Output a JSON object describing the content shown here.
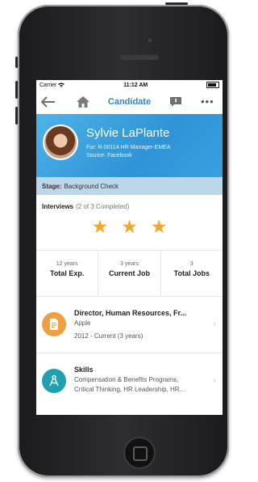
{
  "status_bar": {
    "carrier": "Carrier",
    "time": "11:12 AM"
  },
  "nav": {
    "title": "Candidate",
    "more": "•••",
    "icons": [
      "back-arrow-icon",
      "home-icon",
      "message-icon",
      "more-icon"
    ]
  },
  "candidate": {
    "name": "Sylvie LaPlante",
    "for_line": "For: R-00114 HR Manager-EMEA",
    "source_line": "Source: Facebook"
  },
  "stage": {
    "label": "Stage:",
    "value": "Background Check"
  },
  "interviews": {
    "label": "Interviews",
    "progress": "(2 of 3 Completed)",
    "stars": 3
  },
  "stats": [
    {
      "value": "12 years",
      "label": "Total Exp."
    },
    {
      "value": "3 years",
      "label": "Current Job"
    },
    {
      "value": "3",
      "label": "Total Jobs"
    }
  ],
  "job": {
    "title": "Director, Human Resources, Fr...",
    "company": "Apple",
    "dates": "2012 - Current  (3 years)"
  },
  "skills": {
    "title": "Skills",
    "line1": "Compensation & Benefits Programs,",
    "line2": "Critical Thinking, HR Leadership, HR..."
  },
  "colors": {
    "accent": "#2a86c6",
    "header": "#3aa0de",
    "stage_bg": "#bcd7ea",
    "star": "#f2a72e",
    "job_icon": "#f0a040",
    "skills_icon": "#1fa0b0"
  }
}
